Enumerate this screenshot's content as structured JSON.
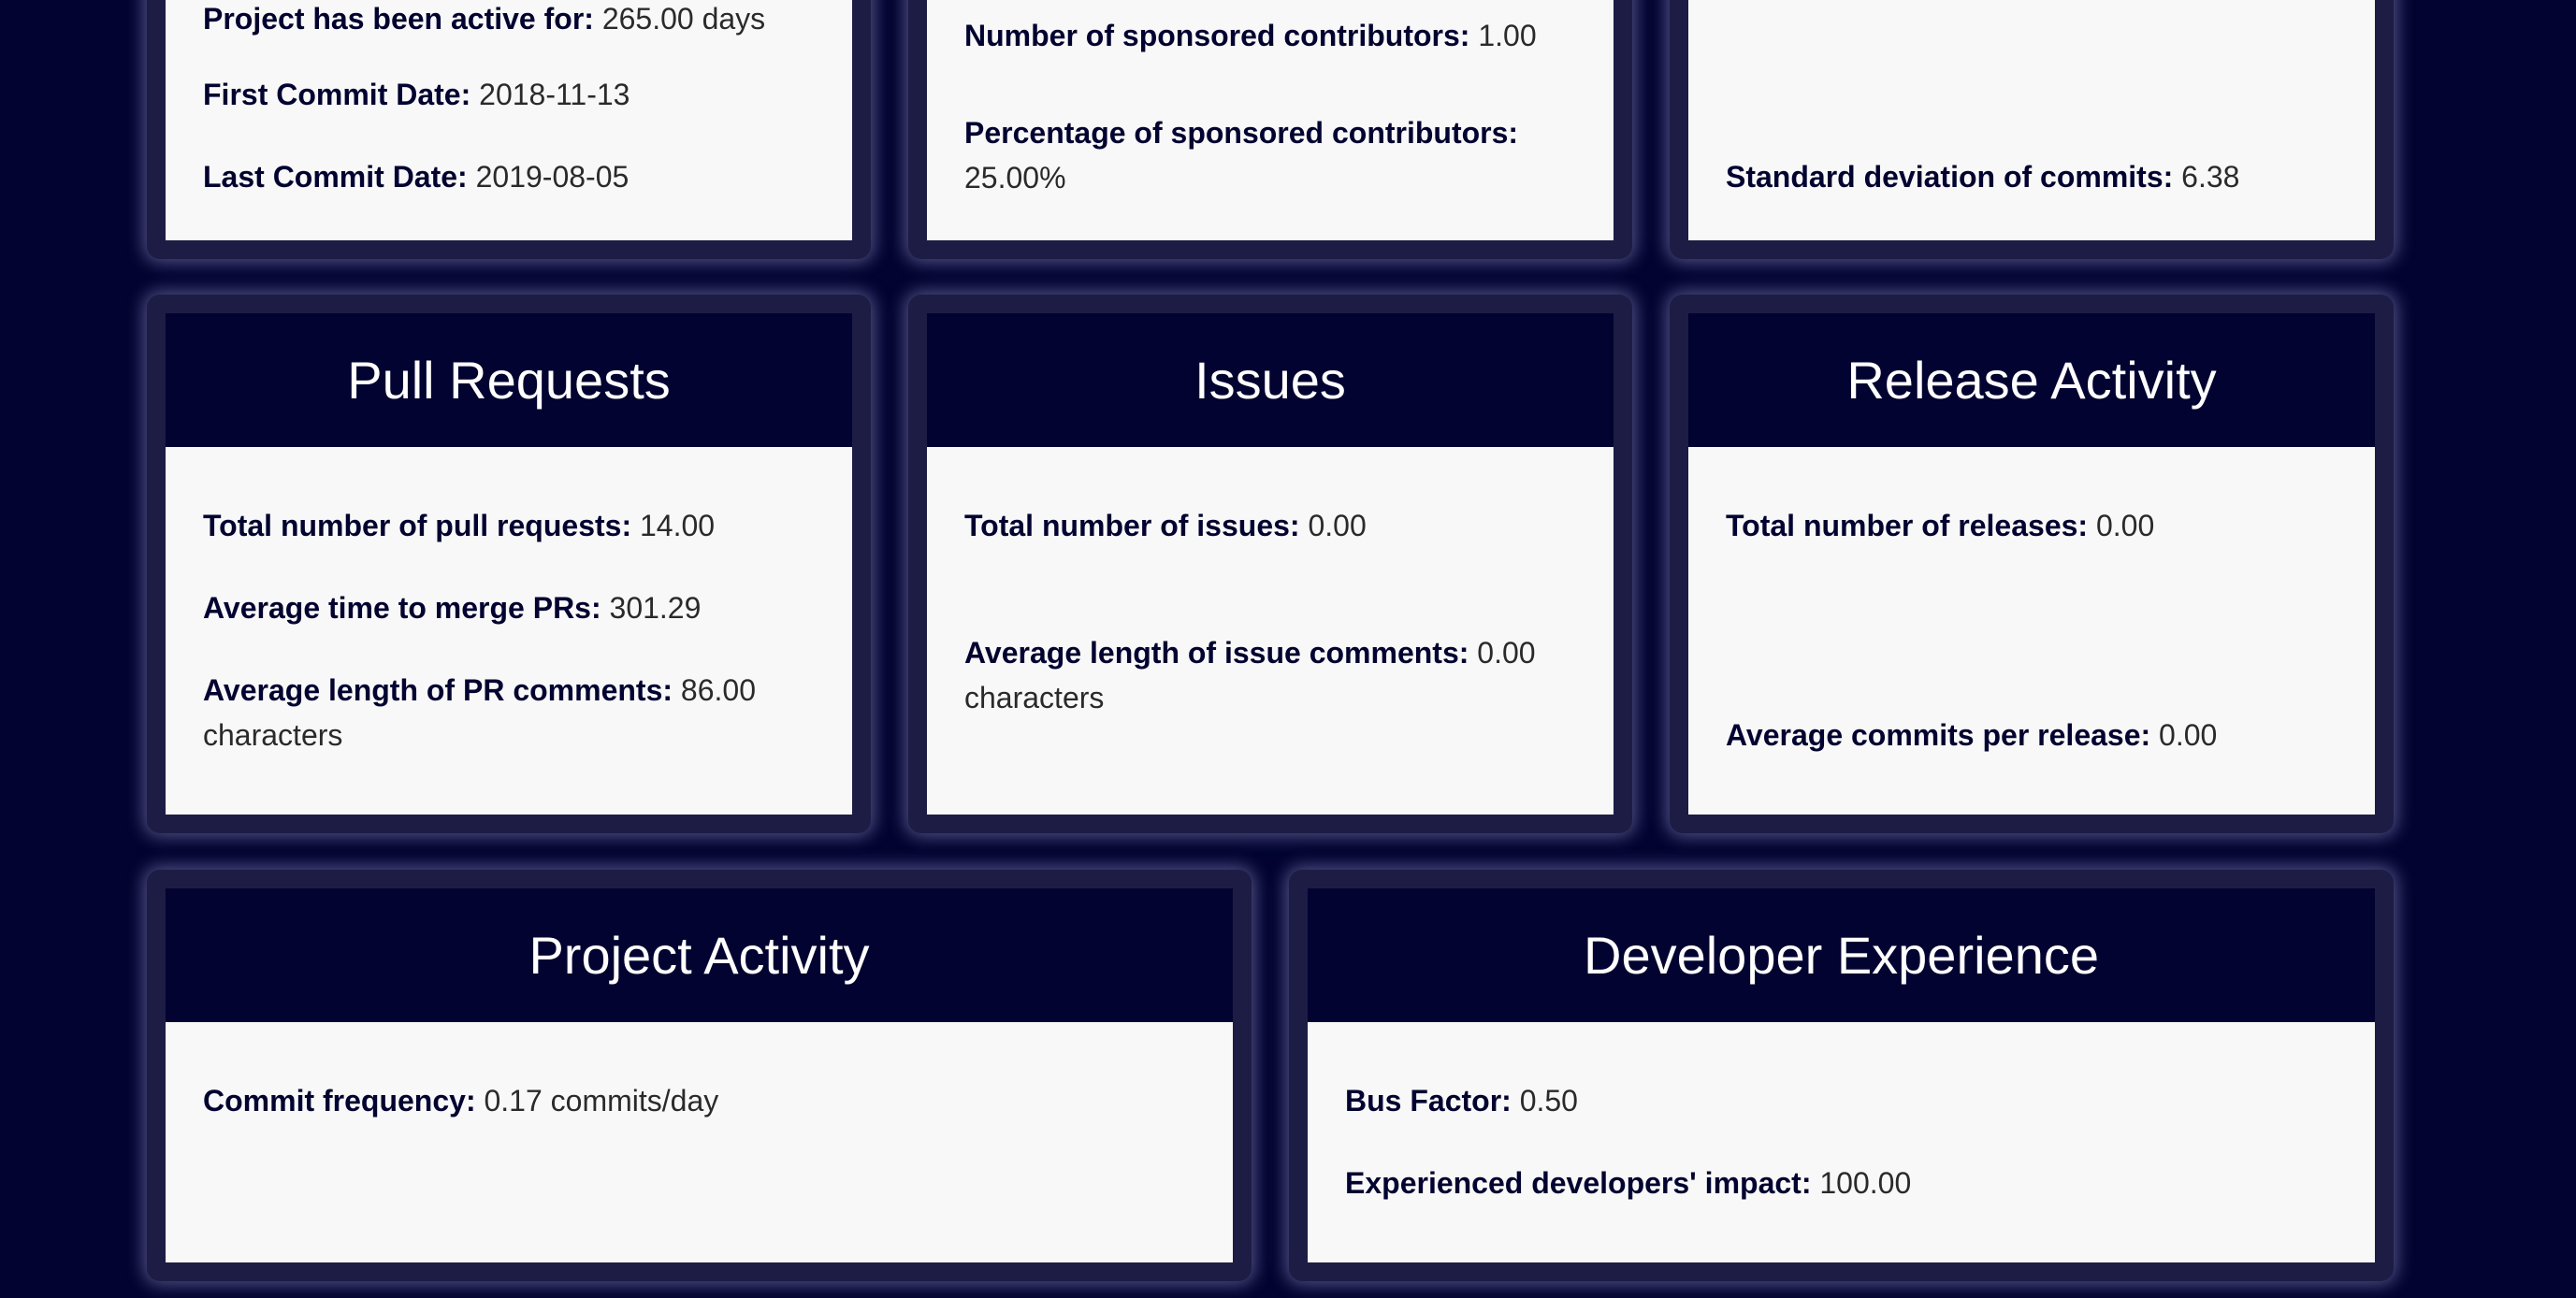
{
  "top_row": {
    "card1": {
      "active_label": "Project has been active for:",
      "active_value": "265.00 days",
      "first_label": "First Commit Date:",
      "first_value": "2018-11-13",
      "last_label": "Last Commit Date:",
      "last_value": "2019-08-05"
    },
    "card2": {
      "sponsored_label": "Number of sponsored contributors:",
      "sponsored_value": "1.00",
      "pct_label": "Percentage of sponsored contributors:",
      "pct_value": "25.00%"
    },
    "card3": {
      "std_label": "Standard deviation of commits:",
      "std_value": "6.38"
    }
  },
  "pull_requests": {
    "title": "Pull Requests",
    "total_label": "Total number of pull requests:",
    "total_value": "14.00",
    "merge_label": "Average time to merge PRs:",
    "merge_value": "301.29",
    "comments_label": "Average length of PR comments:",
    "comments_value": "86.00 characters"
  },
  "issues": {
    "title": "Issues",
    "total_label": "Total number of issues:",
    "total_value": "0.00",
    "comments_label": "Average length of issue comments:",
    "comments_value": "0.00 characters"
  },
  "release_activity": {
    "title": "Release Activity",
    "total_label": "Total number of releases:",
    "total_value": "0.00",
    "avg_label": "Average commits per release:",
    "avg_value": "0.00"
  },
  "project_activity": {
    "title": "Project Activity",
    "freq_label": "Commit frequency:",
    "freq_value": "0.17 commits/day"
  },
  "developer_experience": {
    "title": "Developer Experience",
    "bus_label": "Bus Factor:",
    "bus_value": "0.50",
    "impact_label": "Experienced developers' impact:",
    "impact_value": "100.00"
  },
  "colors": {
    "page_background": "#020330",
    "card_frame": "#1d1c44",
    "card_header": "#020330",
    "card_body": "#f8f8f8",
    "label_text": "#020330",
    "value_text": "#2a2a2a"
  }
}
